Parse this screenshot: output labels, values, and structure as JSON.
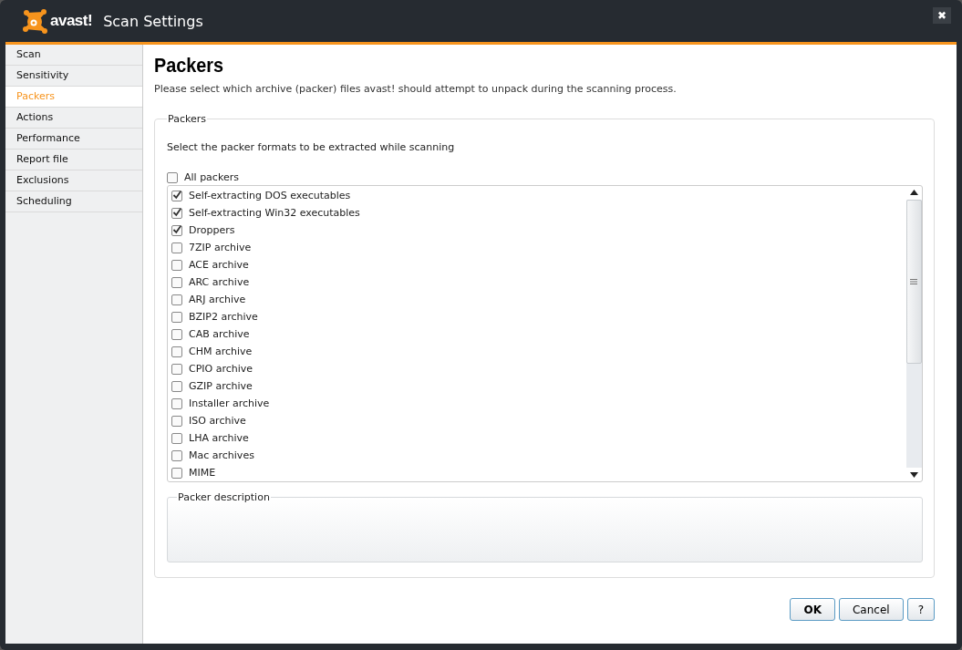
{
  "window": {
    "title": "Scan Settings",
    "logo_text": "avast!",
    "close_label": "✖"
  },
  "sidebar": {
    "items": [
      {
        "label": "Scan",
        "selected": false
      },
      {
        "label": "Sensitivity",
        "selected": false
      },
      {
        "label": "Packers",
        "selected": true
      },
      {
        "label": "Actions",
        "selected": false
      },
      {
        "label": "Performance",
        "selected": false
      },
      {
        "label": "Report file",
        "selected": false
      },
      {
        "label": "Exclusions",
        "selected": false
      },
      {
        "label": "Scheduling",
        "selected": false
      }
    ]
  },
  "page": {
    "heading": "Packers",
    "description": "Please select which archive (packer) files avast! should attempt to unpack during the scanning process."
  },
  "packers_group": {
    "legend": "Packers",
    "instruction": "Select the packer formats to be extracted while scanning",
    "all_packers": {
      "label": "All packers",
      "checked": false
    },
    "items": [
      {
        "label": "Self-extracting DOS executables",
        "checked": true
      },
      {
        "label": "Self-extracting Win32 executables",
        "checked": true
      },
      {
        "label": "Droppers",
        "checked": true
      },
      {
        "label": "7ZIP archive",
        "checked": false
      },
      {
        "label": "ACE archive",
        "checked": false
      },
      {
        "label": "ARC archive",
        "checked": false
      },
      {
        "label": "ARJ archive",
        "checked": false
      },
      {
        "label": "BZIP2 archive",
        "checked": false
      },
      {
        "label": "CAB archive",
        "checked": false
      },
      {
        "label": "CHM archive",
        "checked": false
      },
      {
        "label": "CPIO archive",
        "checked": false
      },
      {
        "label": "GZIP archive",
        "checked": false
      },
      {
        "label": "Installer archive",
        "checked": false
      },
      {
        "label": "ISO archive",
        "checked": false
      },
      {
        "label": "LHA archive",
        "checked": false
      },
      {
        "label": "Mac archives",
        "checked": false
      },
      {
        "label": "MIME",
        "checked": false
      }
    ],
    "description_legend": "Packer description"
  },
  "buttons": [
    {
      "label": "OK",
      "kind": "default"
    },
    {
      "label": "Cancel",
      "kind": "normal"
    },
    {
      "label": "?",
      "kind": "help"
    }
  ]
}
